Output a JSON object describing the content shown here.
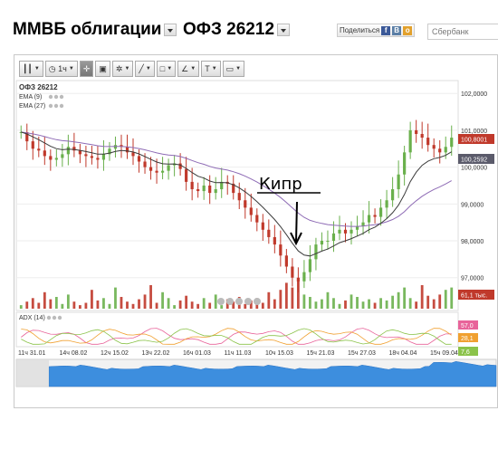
{
  "header": {
    "market": "ММВБ облигации",
    "instrument": "ОФЗ 26212",
    "share_label": "Поделиться",
    "search_value": "Сбербанк"
  },
  "toolbar": {
    "interval": "1ч",
    "text_tool": "T"
  },
  "chart_data": [
    {
      "type": "candlestick",
      "title": "ОФЗ 26212",
      "legend": [
        "EMA (9)",
        "EMA (27)"
      ],
      "y_ticks": [
        "102,0000",
        "101,0000",
        "100,0000",
        "99,0000",
        "98,0000",
        "97,0000"
      ],
      "ylim": [
        96.6,
        102.3
      ],
      "price_labels": [
        "100,8001",
        "100,2592"
      ],
      "close_series": [
        100.95,
        100.7,
        100.5,
        100.45,
        100.3,
        100.2,
        100.25,
        100.35,
        100.55,
        100.45,
        100.35,
        100.3,
        100.25,
        100.2,
        100.35,
        100.5,
        100.6,
        100.55,
        100.4,
        100.3,
        100.15,
        100.0,
        99.9,
        99.85,
        99.9,
        100.05,
        100.1,
        99.95,
        99.6,
        99.4,
        99.35,
        99.5,
        99.3,
        99.4,
        99.6,
        99.55,
        99.3,
        99.1,
        98.9,
        98.7,
        98.5,
        98.3,
        98.1,
        97.9,
        97.6,
        97.3,
        97.0,
        96.9,
        97.15,
        97.5,
        97.9,
        98.0,
        98.0,
        98.2,
        98.3,
        98.2,
        98.3,
        98.4,
        98.5,
        98.7,
        98.65,
        98.9,
        99.1,
        99.4,
        99.8,
        100.4,
        101.0,
        100.9,
        100.8,
        100.6,
        100.5,
        100.4,
        100.55,
        100.8
      ],
      "annotation": "Кипр"
    },
    {
      "type": "bar",
      "series": "volume",
      "last_value_label": "61,1 тыс."
    },
    {
      "type": "line",
      "title": "ADX (14)",
      "series": [
        {
          "color": "#e8649a",
          "last_label": "57,0"
        },
        {
          "color": "#f0a030",
          "last_label": "28,1"
        },
        {
          "color": "#8bc34a",
          "last_label": "7,6"
        }
      ]
    }
  ],
  "x_ticks": [
    "11ч 31.01",
    "14ч 08.02",
    "12ч 15.02",
    "13ч 22.02",
    "16ч 01.03",
    "11ч 11.03",
    "10ч 15.03",
    "15ч 21.03",
    "15ч 27.03",
    "18ч 04.04",
    "15ч 09.04"
  ],
  "colors": {
    "up": "#6ab04c",
    "down": "#c0392b",
    "ema9": "#3b3b3b",
    "ema27": "#8e6bb5",
    "label_red": "#c0392b",
    "label_gray": "#5b5b6b",
    "nav_fill": "#3d8ede"
  }
}
